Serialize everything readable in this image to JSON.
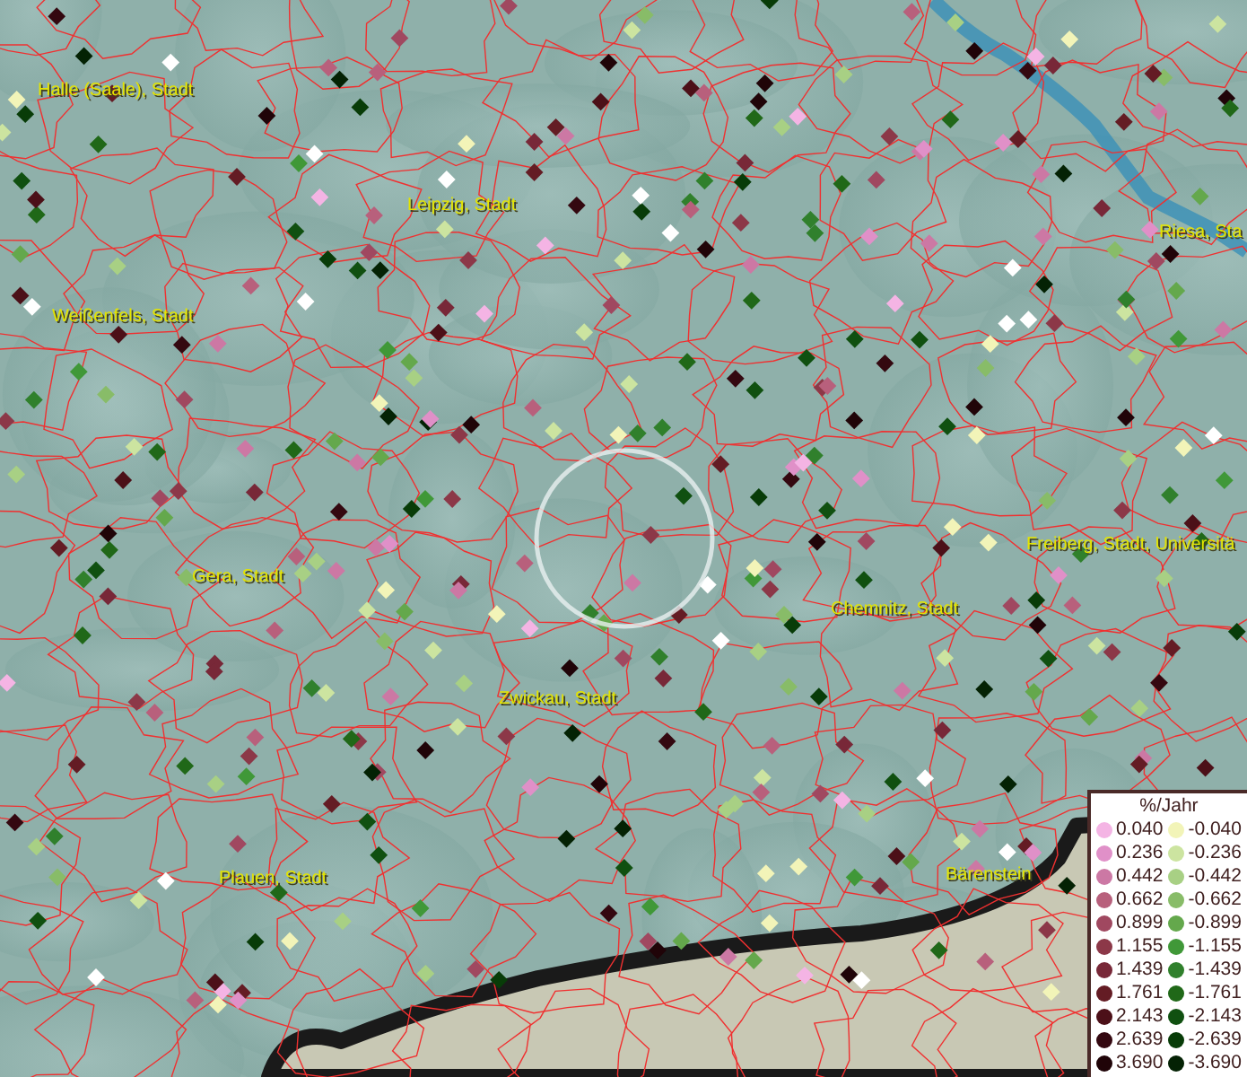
{
  "map": {
    "places": [
      {
        "name": "Halle (Saale), Stadt"
      },
      {
        "name": "Leipzig, Stadt"
      },
      {
        "name": "Weißenfels, Stadt"
      },
      {
        "name": "Riesa, Sta"
      },
      {
        "name": "Freiberg, Stadt, Universitä"
      },
      {
        "name": "Gera, Stadt"
      },
      {
        "name": "Chemnitz, Stadt"
      },
      {
        "name": "Zwickau, Stadt"
      },
      {
        "name": "Plauen, Stadt"
      },
      {
        "name": "Bärenstein"
      }
    ]
  },
  "legend": {
    "title": "%/Jahr",
    "rows": [
      {
        "left": {
          "value": "0.040",
          "color": "#f4b4e4"
        },
        "right": {
          "value": "-0.040",
          "color": "#f2f4b8"
        }
      },
      {
        "left": {
          "value": "0.236",
          "color": "#e090c8"
        },
        "right": {
          "value": "-0.236",
          "color": "#cce4a0"
        }
      },
      {
        "left": {
          "value": "0.442",
          "color": "#cc78a4"
        },
        "right": {
          "value": "-0.442",
          "color": "#a8d084"
        }
      },
      {
        "left": {
          "value": "0.662",
          "color": "#b8607c"
        },
        "right": {
          "value": "-0.662",
          "color": "#88bc68"
        }
      },
      {
        "left": {
          "value": "0.899",
          "color": "#a04860"
        },
        "right": {
          "value": "-0.899",
          "color": "#64a84c"
        }
      },
      {
        "left": {
          "value": "1.155",
          "color": "#8c3848"
        },
        "right": {
          "value": "-1.155",
          "color": "#409838"
        }
      },
      {
        "left": {
          "value": "1.439",
          "color": "#782838"
        },
        "right": {
          "value": "-1.439",
          "color": "#30802c"
        }
      },
      {
        "left": {
          "value": "1.761",
          "color": "#641c24"
        },
        "right": {
          "value": "-1.761",
          "color": "#206818"
        }
      },
      {
        "left": {
          "value": "2.143",
          "color": "#4c1018"
        },
        "right": {
          "value": "-2.143",
          "color": "#105010"
        }
      },
      {
        "left": {
          "value": "2.639",
          "color": "#340810"
        },
        "right": {
          "value": "-2.639",
          "color": "#083c08"
        }
      },
      {
        "left": {
          "value": "3.690",
          "color": "#200408"
        },
        "right": {
          "value": "-3.690",
          "color": "#042204"
        }
      }
    ]
  }
}
